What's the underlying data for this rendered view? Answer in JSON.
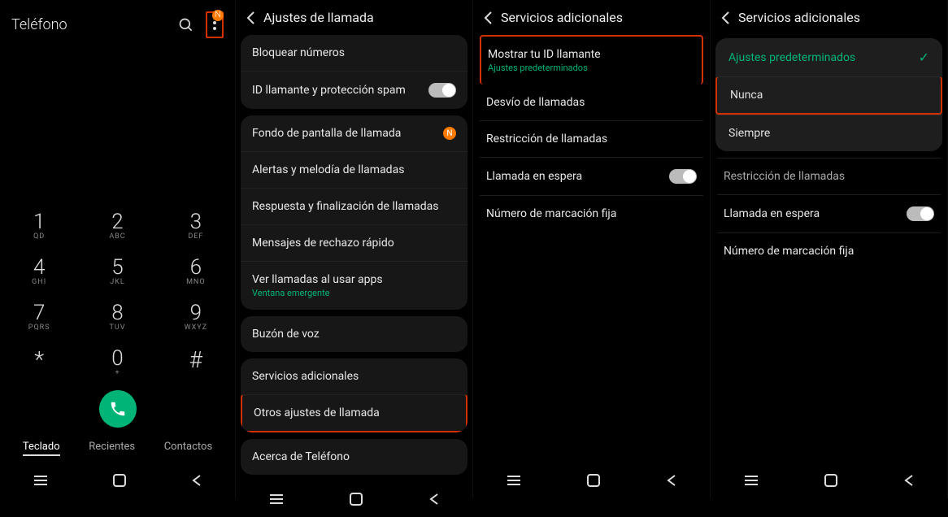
{
  "screen1": {
    "title": "Teléfono",
    "badge": "N",
    "dialpad": [
      {
        "num": "1",
        "sub": "QD"
      },
      {
        "num": "2",
        "sub": "ABC"
      },
      {
        "num": "3",
        "sub": "DEF"
      },
      {
        "num": "4",
        "sub": "GHI"
      },
      {
        "num": "5",
        "sub": "JKL"
      },
      {
        "num": "6",
        "sub": "MNO"
      },
      {
        "num": "7",
        "sub": "PQRS"
      },
      {
        "num": "8",
        "sub": "TUV"
      },
      {
        "num": "9",
        "sub": "WXYZ"
      },
      {
        "sym": "*"
      },
      {
        "num": "0",
        "sub": "+"
      },
      {
        "sym": "#"
      }
    ],
    "tabs": {
      "keypad": "Teclado",
      "recents": "Recientes",
      "contacts": "Contactos"
    }
  },
  "screen2": {
    "title": "Ajustes de llamada",
    "group1": {
      "block": "Bloquear números",
      "callerid": "ID llamante y protección spam"
    },
    "group2": {
      "wallpaper": "Fondo de pantalla de llamada",
      "alerts": "Alertas y melodía de llamadas",
      "answer": "Respuesta y finalización de llamadas",
      "reject": "Mensajes de rechazo rápido",
      "overapps": "Ver llamadas al usar apps",
      "overapps_sub": "Ventana emergente"
    },
    "group3": {
      "voicemail": "Buzón de voz"
    },
    "group4": {
      "extra": "Servicios adicionales",
      "other": "Otros ajustes de llamada"
    },
    "group5": {
      "about": "Acerca de Teléfono"
    }
  },
  "screen3": {
    "title": "Servicios adicionales",
    "showid": "Mostrar tu ID llamante",
    "showid_sub": "Ajustes predeterminados",
    "forward": "Desvío de llamadas",
    "restrict": "Restricción de llamadas",
    "waiting": "Llamada en espera",
    "fixed": "Número de marcación fija"
  },
  "screen4": {
    "title": "Servicios adicionales",
    "opt_default": "Ajustes predeterminados",
    "opt_never": "Nunca",
    "opt_always": "Siempre",
    "restrict": "Restricción de llamadas",
    "waiting": "Llamada en espera",
    "fixed": "Número de marcación fija"
  }
}
